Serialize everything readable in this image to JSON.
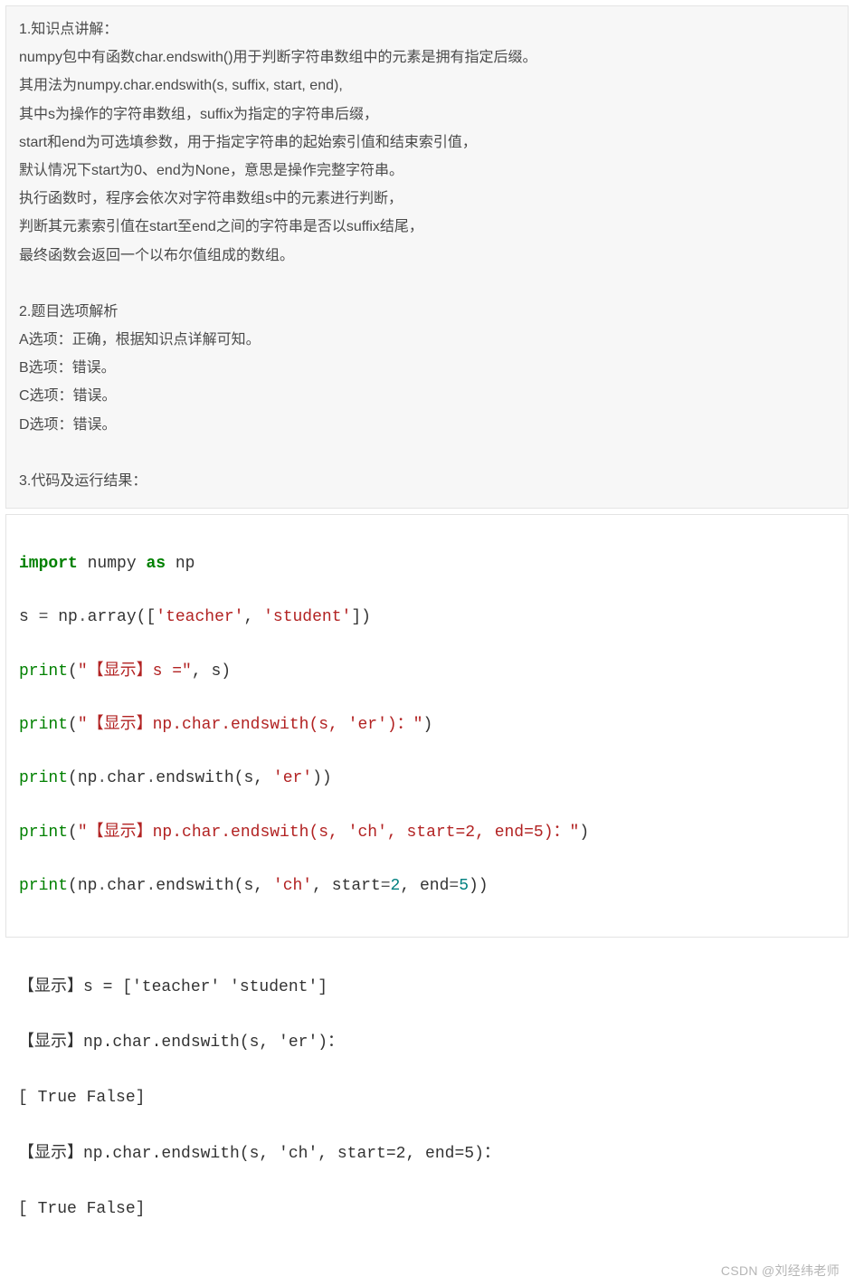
{
  "explain": {
    "lines": [
      "1.知识点讲解：",
      "numpy包中有函数char.endswith()用于判断字符串数组中的元素是拥有指定后缀。",
      "其用法为numpy.char.endswith(s, suffix, start, end),",
      "其中s为操作的字符串数组，suffix为指定的字符串后缀，",
      "start和end为可选填参数，用于指定字符串的起始索引值和结束索引值，",
      "默认情况下start为0、end为None，意思是操作完整字符串。",
      "执行函数时，程序会依次对字符串数组s中的元素进行判断，",
      "判断其元素索引值在start至end之间的字符串是否以suffix结尾，",
      "最终函数会返回一个以布尔值组成的数组。",
      "",
      "2.题目选项解析",
      "A选项：正确，根据知识点详解可知。",
      "B选项：错误。",
      "C选项：错误。",
      "D选项：错误。",
      "",
      "3.代码及运行结果："
    ]
  },
  "code": {
    "l1_import": "import",
    "l1_numpy": " numpy ",
    "l1_as": "as",
    "l1_np": " np",
    "l2_a": "s ",
    "l2_eq": "=",
    "l2_b": " np",
    "l2_dot": ".",
    "l2_c": "array([",
    "l2_s1": "'teacher'",
    "l2_cm": ", ",
    "l2_s2": "'student'",
    "l2_d": "])",
    "print": "print",
    "l3_open": "(",
    "l3_s": "\"【显示】s =\"",
    "l3_mid": ", s)",
    "l4_s": "\"【显示】np.char.endswith(s, 'er')：\"",
    "l4_close": ")",
    "l5_a": "(np",
    "l5_b": "char",
    "l5_c": "endswith(s, ",
    "l5_s": "'er'",
    "l5_d": "))",
    "l6_s": "\"【显示】np.char.endswith(s, 'ch', start=2, end=5)：\"",
    "l7_a": "(np",
    "l7_b": "char",
    "l7_c": "endswith(s, ",
    "l7_s": "'ch'",
    "l7_d": ", start",
    "l7_e": "=",
    "l7_n2": "2",
    "l7_f": ", end",
    "l7_n5": "5",
    "l7_g": "))",
    "dot": "."
  },
  "output": {
    "lines": [
      "【显示】s = ['teacher' 'student']",
      "【显示】np.char.endswith(s, 'er')：",
      "[ True False]",
      "【显示】np.char.endswith(s, 'ch', start=2, end=5)：",
      "[ True False]"
    ]
  },
  "watermark": "CSDN @刘经纬老师"
}
